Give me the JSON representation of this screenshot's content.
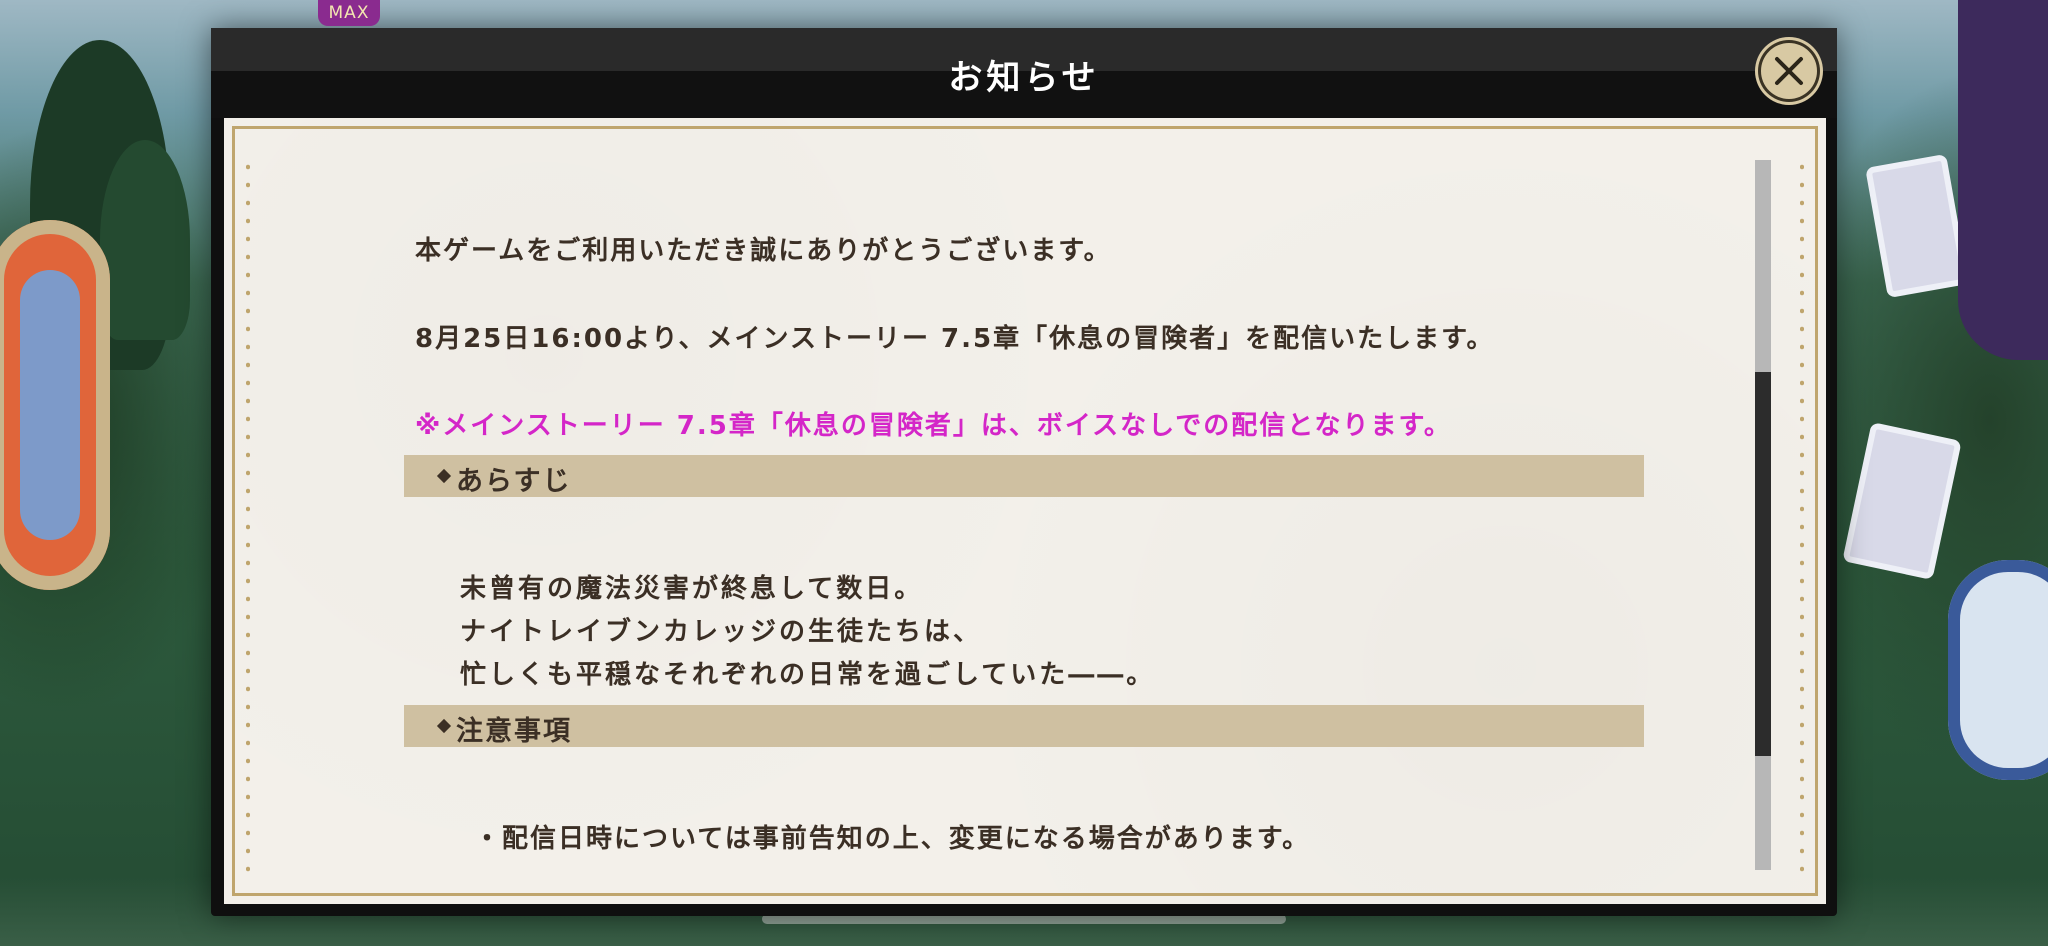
{
  "badge": {
    "max_label": "MAX"
  },
  "dialog": {
    "title": "お知らせ",
    "close_label": "close"
  },
  "notice": {
    "thanks": "本ゲームをご利用いただき誠にありがとうございます。",
    "announcement": "8月25日16:00より、メインストーリー 7.5章「休息の冒険者」を配信いたします。",
    "voice_note": "※メインストーリー 7.5章「休息の冒険者」は、ボイスなしでの配信となります。",
    "sections": [
      {
        "title": "あらすじ",
        "lines": [
          "未曾有の魔法災害が終息して数日。",
          "ナイトレイブンカレッジの生徒たちは、",
          "忙しくも平穏なそれぞれの日常を過ごしていた――。"
        ]
      },
      {
        "title": "注意事項",
        "lines": [
          "・配信日時については事前告知の上、変更になる場合があります。"
        ]
      }
    ]
  },
  "colors": {
    "accent_magenta": "#d426c8",
    "text_dark": "#3b2f25",
    "section_bar": "#cfc0a1",
    "paper": "#f3f0ea",
    "gold_border": "#bfa56d"
  },
  "icons": {
    "close": "close-x-icon",
    "section_marker": "diamond-icon"
  }
}
